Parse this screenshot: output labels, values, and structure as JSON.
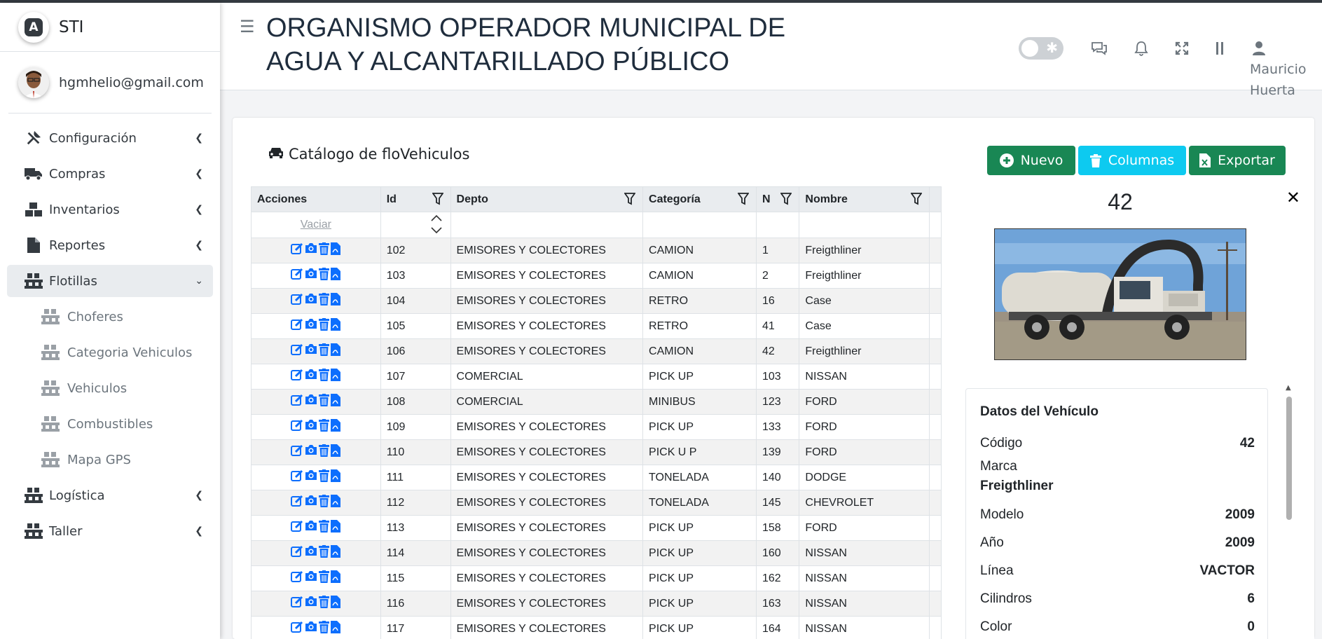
{
  "brand": {
    "name": "STI",
    "logo_letter": "A"
  },
  "user": {
    "email": "hgmhelio@gmail.com",
    "name_line1": "Mauricio",
    "name_line2": "Huerta"
  },
  "header": {
    "title": "ORGANISMO OPERADOR MUNICIPAL DE AGUA Y ALCANTARILLADO PÚBLICO"
  },
  "nav": {
    "configuracion": "Configuración",
    "compras": "Compras",
    "inventarios": "Inventarios",
    "reportes": "Reportes",
    "flotillas": "Flotillas",
    "choferes": "Choferes",
    "categoria_vehiculos": "Categoria Vehiculos",
    "vehiculos": "Vehiculos",
    "combustibles": "Combustibles",
    "mapa_gps": "Mapa GPS",
    "logistica": "Logística",
    "taller": "Taller"
  },
  "page": {
    "title": "Catálogo de floVehiculos",
    "btn_nuevo": "Nuevo",
    "btn_columnas": "Columnas",
    "btn_exportar": "Exportar",
    "vaciar": "Vaciar"
  },
  "table": {
    "headers": [
      "Acciones",
      "Id",
      "Depto",
      "Categoría",
      "N",
      "Nombre"
    ],
    "rows": [
      [
        "102",
        "EMISORES Y COLECTORES",
        "CAMION",
        "1",
        "Freigthliner"
      ],
      [
        "103",
        "EMISORES Y COLECTORES",
        "CAMION",
        "2",
        "Freigthliner"
      ],
      [
        "104",
        "EMISORES Y COLECTORES",
        "RETRO",
        "16",
        "Case"
      ],
      [
        "105",
        "EMISORES Y COLECTORES",
        "RETRO",
        "41",
        "Case"
      ],
      [
        "106",
        "EMISORES Y COLECTORES",
        "CAMION",
        "42",
        "Freigthliner"
      ],
      [
        "107",
        "COMERCIAL",
        "PICK UP",
        "103",
        "NISSAN"
      ],
      [
        "108",
        "COMERCIAL",
        "MINIBUS",
        "123",
        "FORD"
      ],
      [
        "109",
        "EMISORES Y COLECTORES",
        "PICK UP",
        "133",
        "FORD"
      ],
      [
        "110",
        "EMISORES Y COLECTORES",
        "PICK U P",
        "139",
        "FORD"
      ],
      [
        "111",
        "EMISORES Y COLECTORES",
        "TONELADA",
        "140",
        "DODGE"
      ],
      [
        "112",
        "EMISORES Y COLECTORES",
        "TONELADA",
        "145",
        "CHEVROLET"
      ],
      [
        "113",
        "EMISORES Y COLECTORES",
        "PICK UP",
        "158",
        "FORD"
      ],
      [
        "114",
        "EMISORES Y COLECTORES",
        "PICK UP",
        "160",
        "NISSAN"
      ],
      [
        "115",
        "EMISORES Y COLECTORES",
        "PICK UP",
        "162",
        "NISSAN"
      ],
      [
        "116",
        "EMISORES Y COLECTORES",
        "PICK UP",
        "163",
        "NISSAN"
      ],
      [
        "117",
        "EMISORES Y COLECTORES",
        "PICK UP",
        "164",
        "NISSAN"
      ]
    ]
  },
  "detail": {
    "number": "42",
    "card_title": "Datos del Vehículo",
    "codigo_label": "Código",
    "codigo": "42",
    "marca_label": "Marca",
    "marca": "Freigthliner",
    "modelo_label": "Modelo",
    "modelo": "2009",
    "anio_label": "Año",
    "anio": "2009",
    "linea_label": "Línea",
    "linea": "VACTOR",
    "cilindros_label": "Cilindros",
    "cilindros": "6",
    "color_label": "Color",
    "color": "0"
  },
  "colors": {
    "success": "#198754",
    "info": "#0dcaf0",
    "action_icon": "#0d6efd"
  }
}
